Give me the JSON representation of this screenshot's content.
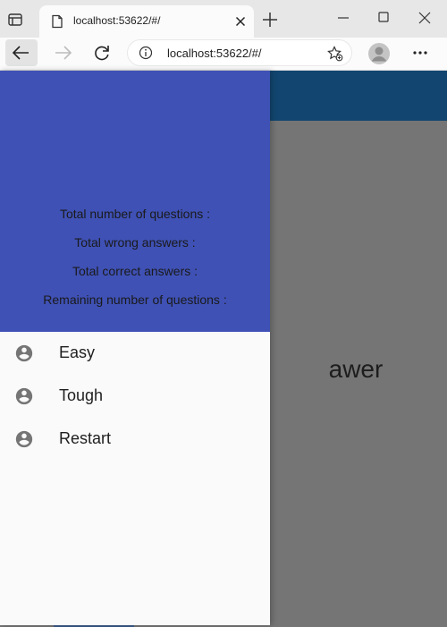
{
  "browser": {
    "tab_title": "localhost:53622/#/",
    "address": "localhost:53622/#/"
  },
  "page": {
    "background_text": "awer"
  },
  "drawer": {
    "header_color": "#3f51b5",
    "stats": [
      {
        "label": "Total number of questions :"
      },
      {
        "label": "Total wrong answers :"
      },
      {
        "label": "Total correct answers :"
      },
      {
        "label": "Remaining number of questions :"
      }
    ],
    "menu": [
      {
        "label": "Easy",
        "icon": "account-circle-icon"
      },
      {
        "label": "Tough",
        "icon": "account-circle-icon"
      },
      {
        "label": "Restart",
        "icon": "account-circle-icon"
      }
    ]
  },
  "colors": {
    "appbar": "#124670",
    "scrim": "#757575"
  }
}
